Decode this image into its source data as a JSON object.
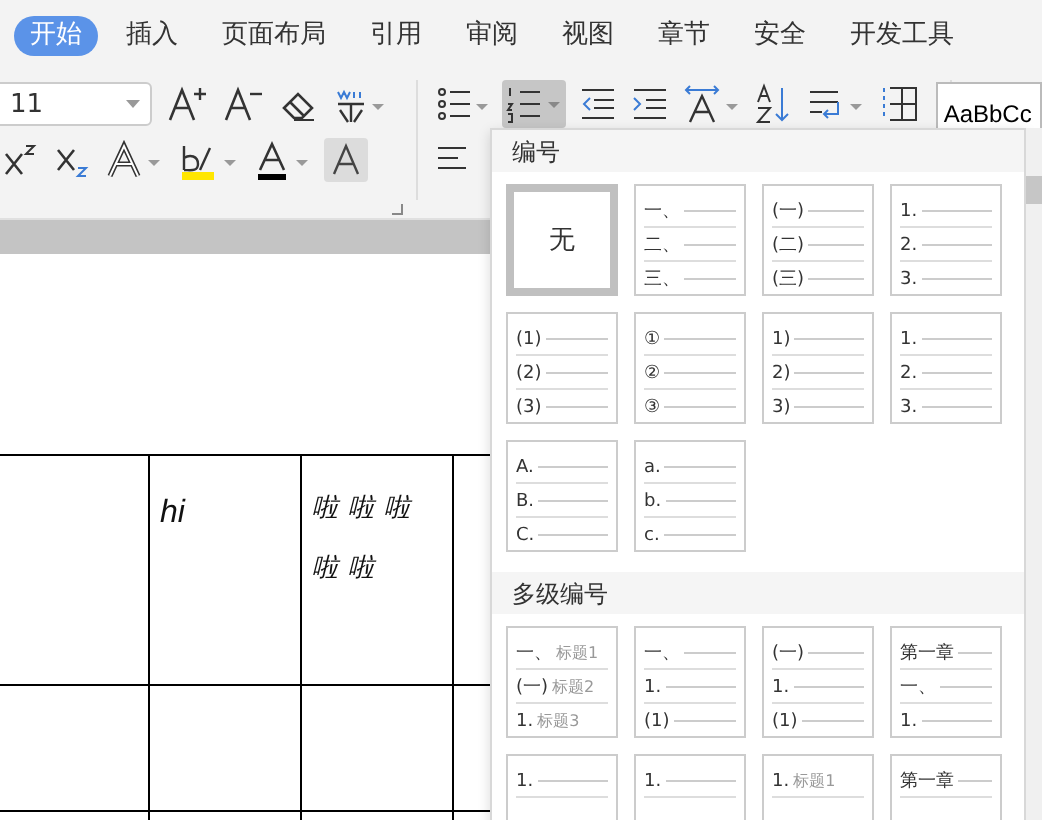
{
  "tabs": [
    {
      "label": "开始",
      "selected": true
    },
    {
      "label": "插入",
      "selected": false
    },
    {
      "label": "页面布局",
      "selected": false
    },
    {
      "label": "引用",
      "selected": false
    },
    {
      "label": "审阅",
      "selected": false
    },
    {
      "label": "视图",
      "selected": false
    },
    {
      "label": "章节",
      "selected": false
    },
    {
      "label": "安全",
      "selected": false
    },
    {
      "label": "开发工具",
      "selected": false
    }
  ],
  "font_size": "11",
  "style_preview": "AaBbCc",
  "table": {
    "rows": [
      [
        "",
        "hi",
        "啦啦啦啦啦",
        ""
      ],
      [
        "",
        "",
        "",
        ""
      ],
      [
        "",
        "",
        "",
        ""
      ]
    ]
  },
  "numbering_menu": {
    "sections": [
      {
        "title": "编号",
        "tiles": [
          {
            "kind": "none",
            "label": "无",
            "selected": true
          },
          {
            "kind": "list",
            "selected": false,
            "lines": [
              {
                "num": "一、"
              },
              {
                "num": "二、"
              },
              {
                "num": "三、"
              }
            ]
          },
          {
            "kind": "list",
            "selected": false,
            "lines": [
              {
                "num": "(一)"
              },
              {
                "num": "(二)"
              },
              {
                "num": "(三)"
              }
            ]
          },
          {
            "kind": "list",
            "selected": false,
            "lines": [
              {
                "num": "1."
              },
              {
                "num": "2."
              },
              {
                "num": "3."
              }
            ]
          },
          {
            "kind": "list",
            "selected": false,
            "lines": [
              {
                "num": "(1)"
              },
              {
                "num": "(2)"
              },
              {
                "num": "(3)"
              }
            ]
          },
          {
            "kind": "list",
            "selected": false,
            "lines": [
              {
                "num": "①"
              },
              {
                "num": "②"
              },
              {
                "num": "③"
              }
            ]
          },
          {
            "kind": "list",
            "selected": false,
            "lines": [
              {
                "num": "1)"
              },
              {
                "num": "2)"
              },
              {
                "num": "3)"
              }
            ]
          },
          {
            "kind": "list",
            "selected": false,
            "lines": [
              {
                "num": "1."
              },
              {
                "num": "2."
              },
              {
                "num": "3."
              }
            ]
          },
          {
            "kind": "list",
            "selected": false,
            "lines": [
              {
                "num": "A."
              },
              {
                "num": "B."
              },
              {
                "num": "C."
              }
            ]
          },
          {
            "kind": "list",
            "selected": false,
            "lines": [
              {
                "num": "a."
              },
              {
                "num": "b."
              },
              {
                "num": "c."
              }
            ]
          }
        ]
      },
      {
        "title": "多级编号",
        "tiles": [
          {
            "kind": "list",
            "selected": false,
            "lines": [
              {
                "num": "一、",
                "text": "标题1"
              },
              {
                "num": "(一)",
                "text": "标题2"
              },
              {
                "num": "1.",
                "text": "标题3"
              }
            ]
          },
          {
            "kind": "list",
            "selected": false,
            "lines": [
              {
                "num": "一、"
              },
              {
                "num": "1."
              },
              {
                "num": "(1)"
              }
            ]
          },
          {
            "kind": "list",
            "selected": false,
            "lines": [
              {
                "num": "(一)"
              },
              {
                "num": "1."
              },
              {
                "num": "(1)"
              }
            ]
          },
          {
            "kind": "list",
            "selected": false,
            "lines": [
              {
                "num": "第一章"
              },
              {
                "num": "一、"
              },
              {
                "num": "1."
              }
            ]
          },
          {
            "kind": "list",
            "selected": false,
            "lines": [
              {
                "num": "1."
              }
            ]
          },
          {
            "kind": "list",
            "selected": false,
            "lines": [
              {
                "num": "1."
              }
            ]
          },
          {
            "kind": "list",
            "selected": false,
            "lines": [
              {
                "num": "1.",
                "text": "标题1"
              }
            ]
          },
          {
            "kind": "list",
            "selected": false,
            "lines": [
              {
                "num": "第一章"
              }
            ]
          }
        ]
      }
    ]
  }
}
